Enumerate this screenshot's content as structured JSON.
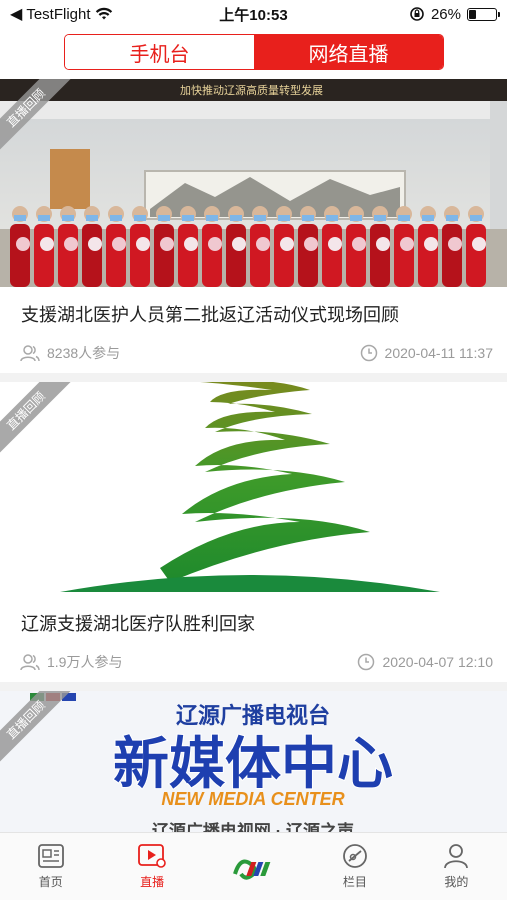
{
  "status_bar": {
    "back_app": "TestFlight",
    "time": "上午10:53",
    "battery_percent": "26%",
    "battery_level": 0.26
  },
  "segment": {
    "tabs": [
      {
        "label": "手机台",
        "active": false
      },
      {
        "label": "网络直播",
        "active": true
      }
    ]
  },
  "feed": {
    "items": [
      {
        "badge": "直播回顾",
        "title": "支援湖北医护人员第二批返辽活动仪式现场回顾",
        "participants": "8238人参与",
        "datetime": "2020-04-11 11:37",
        "banner_text": "加快推动辽源高质量转型发展"
      },
      {
        "badge": "直播回顾",
        "title": "辽源支援湖北医疗队胜利回家",
        "participants": "1.9万人参与",
        "datetime": "2020-04-07 12:10"
      },
      {
        "badge": "直播回顾",
        "logo_top": "辽源广播电视台",
        "logo_main": "新媒体中心",
        "logo_en": "NEW MEDIA CENTER",
        "logo_bottom": "辽源广播电视网 · 辽源之声"
      }
    ]
  },
  "tabbar": {
    "items": [
      {
        "label": "首页",
        "icon": "news-icon"
      },
      {
        "label": "直播",
        "icon": "live-video-icon"
      },
      {
        "label": "",
        "icon": "brand-logo-icon"
      },
      {
        "label": "栏目",
        "icon": "column-icon"
      },
      {
        "label": "我的",
        "icon": "user-icon"
      }
    ]
  },
  "colors": {
    "accent": "#e8201c",
    "muted": "#9a9a9a",
    "ribbon": "#969696"
  }
}
